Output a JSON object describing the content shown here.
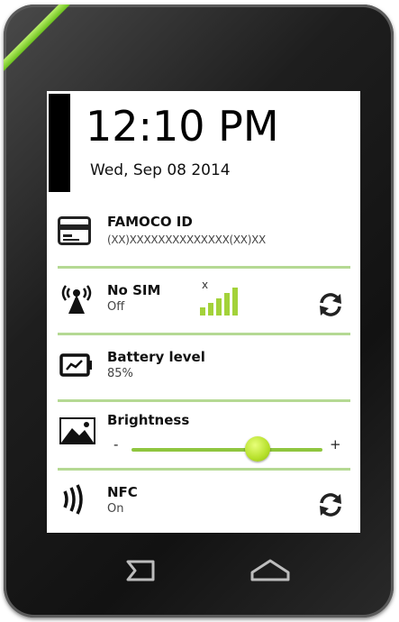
{
  "lock": {
    "time": "12:10 PM",
    "date": "Wed, Sep 08 2014"
  },
  "famoco": {
    "title": "FAMOCO ID",
    "value": "(XX)XXXXXXXXXXXXXX(XX)XX"
  },
  "sim": {
    "title": "No SIM",
    "status": "Off",
    "signal_mark": "x",
    "signal_bars": 5
  },
  "battery": {
    "title": "Battery level",
    "value": "85%"
  },
  "brightness": {
    "title": "Brightness",
    "minus": "-",
    "plus": "+",
    "level": 0.66
  },
  "nfc": {
    "title": "NFC",
    "status": "On"
  },
  "colors": {
    "accent_green": "#8fc63f",
    "separator": "#b5d993"
  },
  "icons": [
    "card-icon",
    "antenna-icon",
    "battery-icon",
    "brightness-image-icon",
    "nfc-icon",
    "refresh-icon",
    "back-icon",
    "home-icon"
  ]
}
